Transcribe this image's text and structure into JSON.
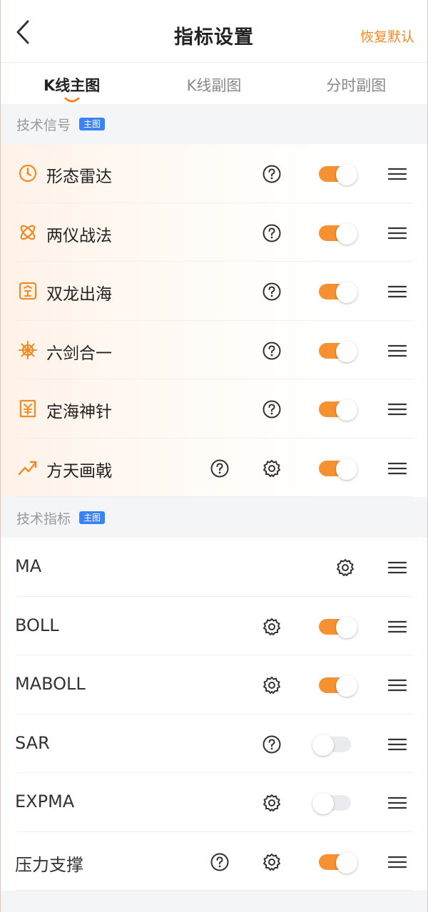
{
  "header": {
    "title": "指标设置",
    "restore_label": "恢复默认"
  },
  "tabs": [
    {
      "label": "K线主图",
      "active": true
    },
    {
      "label": "K线副图",
      "active": false
    },
    {
      "label": "分时副图",
      "active": false
    }
  ],
  "signals": {
    "label": "技术信号",
    "badge": "主图",
    "items": [
      {
        "name": "形态雷达",
        "icon": "radar-icon",
        "toggle_on": true
      },
      {
        "name": "两仪战法",
        "icon": "atom-icon",
        "toggle_on": true
      },
      {
        "name": "双龙出海",
        "icon": "dragon-icon",
        "toggle_on": true
      },
      {
        "name": "六剑合一",
        "icon": "helm-icon",
        "toggle_on": true
      },
      {
        "name": "定海神针",
        "icon": "needle-icon",
        "toggle_on": true
      },
      {
        "name": "方天画戟",
        "icon": "trend-icon",
        "toggle_on": true
      }
    ]
  },
  "indicators": {
    "label": "技术指标",
    "badge": "主图",
    "items": [
      {
        "name": "MA"
      },
      {
        "name": "BOLL",
        "toggle_on": true
      },
      {
        "name": "MABOLL",
        "toggle_on": true
      },
      {
        "name": "SAR",
        "toggle_on": false
      },
      {
        "name": "EXPMA",
        "toggle_on": false
      },
      {
        "name": "压力支撑",
        "toggle_on": true
      }
    ]
  },
  "colors": {
    "accent": "#f59131",
    "badge": "#3b82f6",
    "restore": "#f08a24"
  }
}
